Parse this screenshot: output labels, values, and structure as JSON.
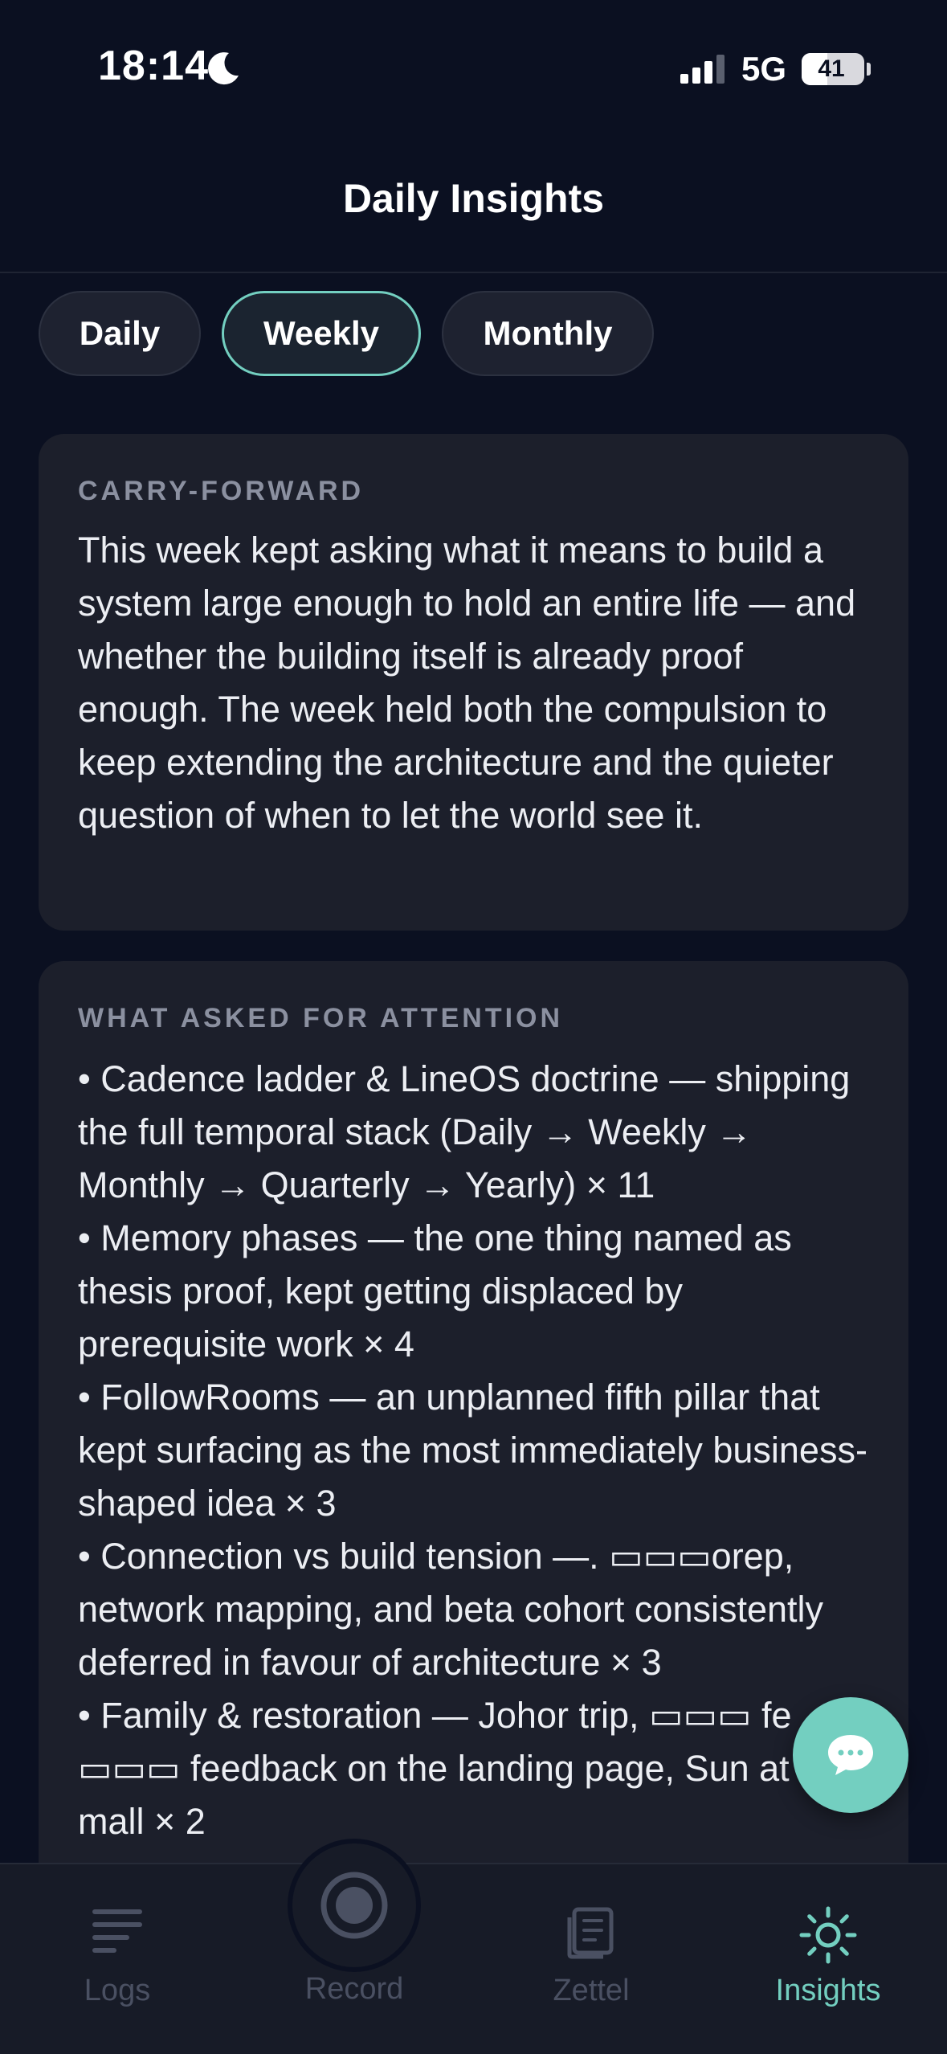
{
  "status_bar": {
    "time": "18:14",
    "network": "5G",
    "battery_level": "41",
    "battery_percent": 41
  },
  "header": {
    "title": "Daily Insights"
  },
  "tabs": [
    {
      "label": "Daily",
      "active": false
    },
    {
      "label": "Weekly",
      "active": true
    },
    {
      "label": "Monthly",
      "active": false
    }
  ],
  "carry_forward": {
    "label": "CARRY-FORWARD",
    "text": "This week kept asking what it means to build a system large enough to hold an entire life — and whether the building itself is already proof enough. The week held both the compulsion to keep extending the architecture and the quieter question of when to let the world see it."
  },
  "attention": {
    "label": "WHAT ASKED FOR ATTENTION",
    "items": [
      "• Cadence ladder & LineOS doctrine — shipping the full temporal stack (Daily → Weekly → Monthly → Quarterly → Yearly) × 11",
      "• Memory phases — the one thing named as thesis proof, kept getting displaced by prerequisite work × 4",
      "• FollowRooms — an unplanned fifth pillar that kept surfacing as the most immediately business-shaped idea × 3",
      "• Connection vs build tension —. ▭▭▭orep, network mapping, and beta cohort consistently deferred in favour of architecture × 3",
      "• Family & restoration — Johor trip, ▭▭▭ fe ▭▭▭ feedback on the landing page, Sun at the mall × 2"
    ]
  },
  "nav": {
    "logs": "Logs",
    "record": "Record",
    "zettel": "Zettel",
    "insights": "Insights"
  },
  "colors": {
    "background": "#0b1021",
    "card": "#1c1f2b",
    "accent": "#73cfc0",
    "muted": "#4a5062"
  },
  "icons": {
    "status": [
      "moon-icon",
      "signal-icon",
      "battery-icon"
    ],
    "fab": "chat-bubble-icon",
    "nav": [
      "logs-icon",
      "record-icon",
      "zettel-icon",
      "insights-sun-icon"
    ]
  }
}
